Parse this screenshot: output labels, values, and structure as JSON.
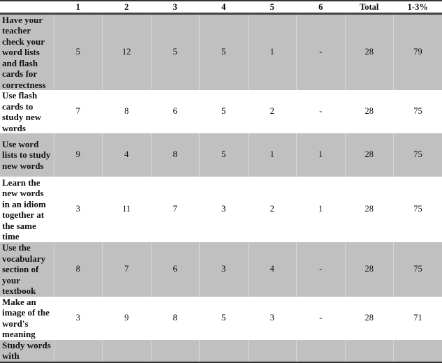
{
  "table": {
    "headers": [
      "",
      "1",
      "2",
      "3",
      "4",
      "5",
      "6",
      "Total",
      "1-3%"
    ],
    "rows": [
      {
        "label": "Have your teacher check your word lists and flash cards for correctness",
        "values": [
          "5",
          "12",
          "5",
          "5",
          "1",
          "-",
          "28",
          "79"
        ]
      },
      {
        "label": "Use flash cards to study new words",
        "values": [
          "7",
          "8",
          "6",
          "5",
          "2",
          "-",
          "28",
          "75"
        ]
      },
      {
        "label": "Use word lists to study new words",
        "values": [
          "9",
          "4",
          "8",
          "5",
          "1",
          "1",
          "28",
          "75"
        ]
      },
      {
        "label": "Learn the new words in an idiom together at the same time",
        "values": [
          "3",
          "11",
          "7",
          "3",
          "2",
          "1",
          "28",
          "75"
        ]
      },
      {
        "label": "Use the vocabulary section of your textbook",
        "values": [
          "8",
          "7",
          "6",
          "3",
          "4",
          "-",
          "28",
          "75"
        ]
      },
      {
        "label": "Make an image of the word's meaning",
        "values": [
          "3",
          "9",
          "8",
          "5",
          "3",
          "-",
          "28",
          "71"
        ]
      },
      {
        "label": "Study words with",
        "values": [
          "",
          "",
          "",
          "",
          "",
          "",
          "",
          ""
        ]
      }
    ]
  },
  "colors": {
    "shaded_row": "#c0c0c0",
    "plain_row": "#ffffff",
    "rule": "#333333"
  }
}
